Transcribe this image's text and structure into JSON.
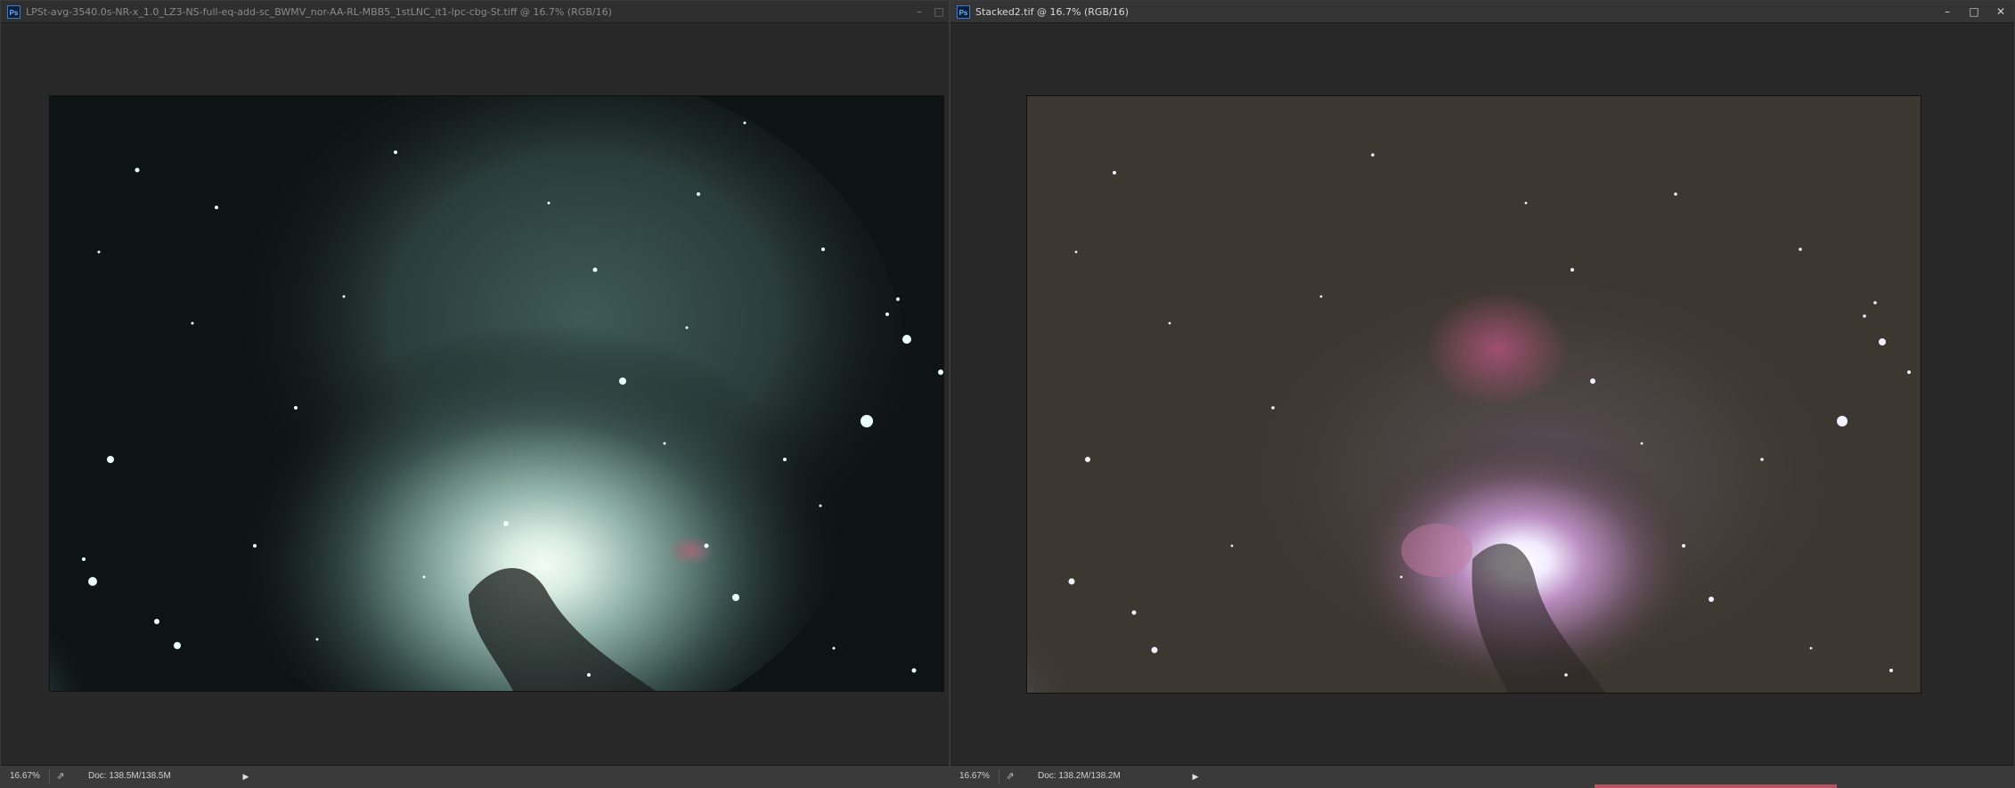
{
  "windows": [
    {
      "title": "LPSt-avg-3540.0s-NR-x_1.0_LZ3-NS-full-eq-add-sc_BWMV_nor-AA-RL-MBB5_1stLNC_it1-lpc-cbg-St.tiff @ 16.7% (RGB/16)",
      "app_icon": "Ps",
      "zoom": "16.67%",
      "doc_info": "Doc: 138.5M/138.5M",
      "image_description_icon": "nebula-image"
    },
    {
      "title": "Stacked2.tif @ 16.7% (RGB/16)",
      "app_icon": "Ps",
      "zoom": "16.67%",
      "doc_info": "Doc: 138.2M/138.2M",
      "image_description_icon": "nebula-image"
    }
  ],
  "controls": {
    "minimize": "–",
    "maximize": "□",
    "close": "✕",
    "share_glyph": "⇗",
    "arrow_glyph": "▶"
  },
  "colors": {
    "accent_bar": "#b55460"
  }
}
